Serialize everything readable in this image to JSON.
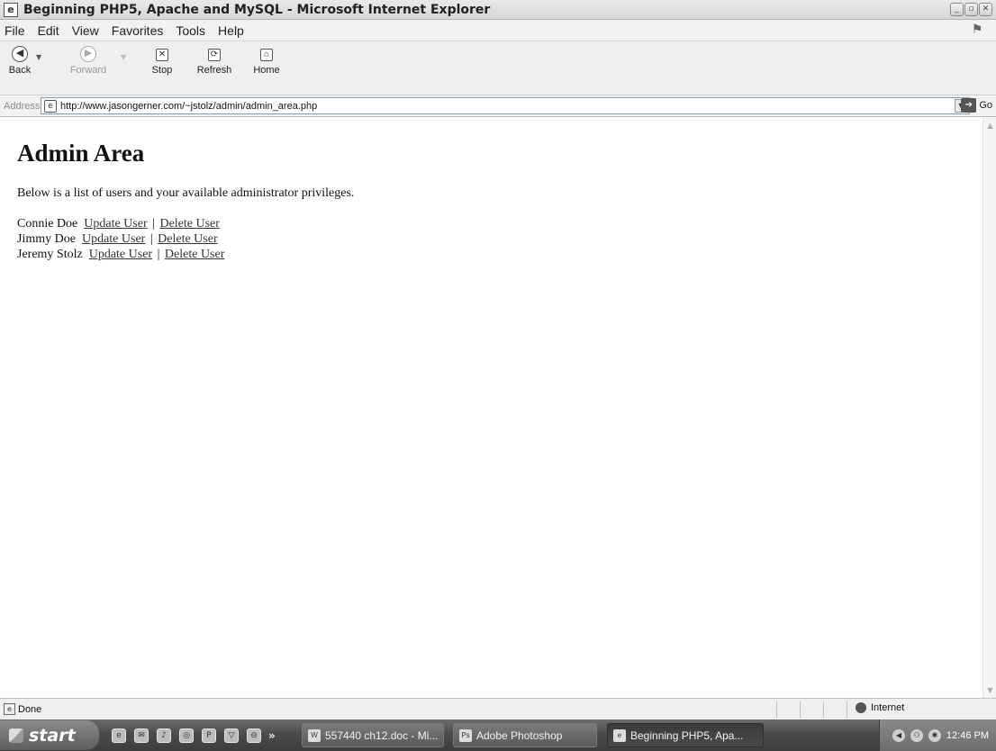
{
  "window": {
    "title": "Beginning PHP5, Apache and MySQL - Microsoft Internet Explorer"
  },
  "menu": [
    "File",
    "Edit",
    "View",
    "Favorites",
    "Tools",
    "Help"
  ],
  "toolbar": {
    "back": "Back",
    "forward": "Forward",
    "stop": "Stop",
    "refresh": "Refresh",
    "home": "Home"
  },
  "address": {
    "label": "Address",
    "url": "http://www.jasongerner.com/~jstolz/admin/admin_area.php",
    "go": "Go"
  },
  "page": {
    "heading": "Admin Area",
    "intro": "Below is a list of users and your available administrator privileges.",
    "users": [
      {
        "name": "Connie Doe",
        "update": "Update User",
        "delete": "Delete User"
      },
      {
        "name": "Jimmy Doe",
        "update": "Update User",
        "delete": "Delete User"
      },
      {
        "name": "Jeremy Stolz",
        "update": "Update User",
        "delete": "Delete User"
      }
    ],
    "separator": "|"
  },
  "status": {
    "text": "Done",
    "zone": "Internet"
  },
  "taskbar": {
    "start": "start",
    "tasks": [
      {
        "label": "557440 ch12.doc - Mi..."
      },
      {
        "label": "Adobe Photoshop"
      },
      {
        "label": "Beginning PHP5, Apa..."
      }
    ],
    "clock": "12:46 PM"
  }
}
